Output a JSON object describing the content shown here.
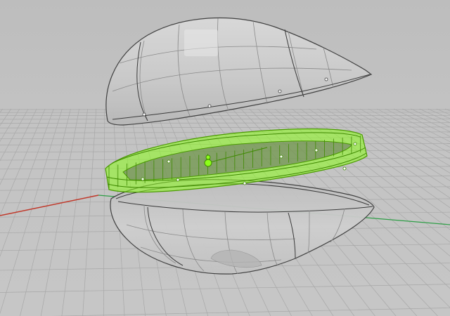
{
  "viewport": {
    "projection": "perspective",
    "display_mode": "ghosted",
    "grid_visible": true,
    "colors": {
      "background": "#c2c2c2",
      "grid_line": "#a8a8a8",
      "x_axis": "#c0392b",
      "y_axis": "#2e9e46",
      "shell_fill": "#cfcfcf",
      "shell_edge": "#3a3a3a",
      "selection_highlight": "#8dff1a",
      "selection_edge": "#4a9a00"
    }
  },
  "scene": {
    "objects": [
      {
        "name": "upper-shell",
        "selected": false
      },
      {
        "name": "lower-shell",
        "selected": false
      },
      {
        "name": "ring-frame",
        "selected": true
      }
    ]
  }
}
